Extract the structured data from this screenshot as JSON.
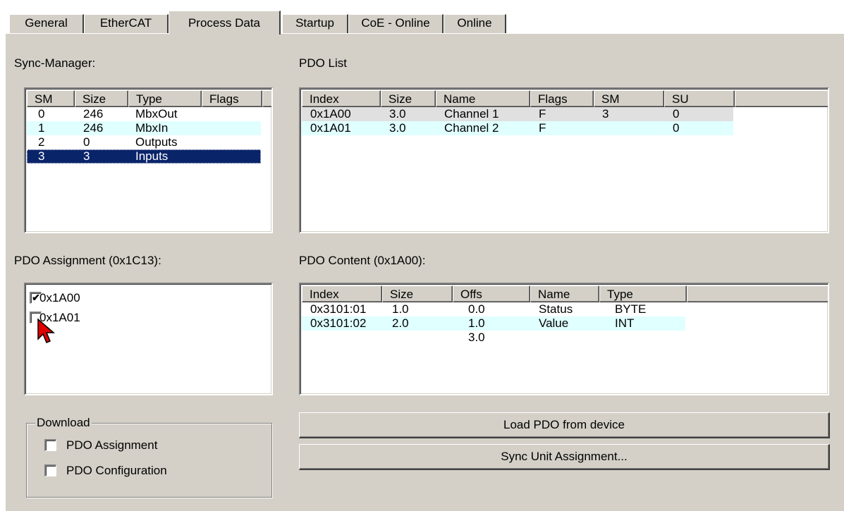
{
  "tabs": [
    {
      "label": "General"
    },
    {
      "label": "EtherCAT"
    },
    {
      "label": "Process Data"
    },
    {
      "label": "Startup"
    },
    {
      "label": "CoE - Online"
    },
    {
      "label": "Online"
    }
  ],
  "sync_manager": {
    "label": "Sync-Manager:",
    "columns": [
      "SM",
      "Size",
      "Type",
      "Flags"
    ],
    "rows": [
      {
        "sm": "0",
        "size": "246",
        "type": "MbxOut",
        "flags": ""
      },
      {
        "sm": "1",
        "size": "246",
        "type": "MbxIn",
        "flags": ""
      },
      {
        "sm": "2",
        "size": "0",
        "type": "Outputs",
        "flags": ""
      },
      {
        "sm": "3",
        "size": "3",
        "type": "Inputs",
        "flags": ""
      }
    ],
    "selected_index": 3
  },
  "pdo_list": {
    "label": "PDO List",
    "columns": [
      "Index",
      "Size",
      "Name",
      "Flags",
      "SM",
      "SU"
    ],
    "rows": [
      {
        "index": "0x1A00",
        "size": "3.0",
        "name": "Channel 1",
        "flags": "F",
        "sm": "3",
        "su": "0"
      },
      {
        "index": "0x1A01",
        "size": "3.0",
        "name": "Channel 2",
        "flags": "F",
        "sm": "",
        "su": "0"
      }
    ]
  },
  "pdo_assignment": {
    "label": "PDO Assignment (0x1C13):",
    "items": [
      {
        "label": "0x1A00",
        "checked": true
      },
      {
        "label": "0x1A01",
        "checked": false
      }
    ]
  },
  "pdo_content": {
    "label": "PDO Content (0x1A00):",
    "columns": [
      "Index",
      "Size",
      "Offs",
      "Name",
      "Type"
    ],
    "rows": [
      {
        "index": "0x3101:01",
        "size": "1.0",
        "offs": "0.0",
        "name": "Status",
        "type": "BYTE"
      },
      {
        "index": "0x3101:02",
        "size": "2.0",
        "offs": "1.0",
        "name": "Value",
        "type": "INT"
      },
      {
        "index": "",
        "size": "",
        "offs": "3.0",
        "name": "",
        "type": ""
      }
    ]
  },
  "download": {
    "title": "Download",
    "options": [
      {
        "label": "PDO Assignment",
        "checked": false
      },
      {
        "label": "PDO Configuration",
        "checked": false
      }
    ]
  },
  "buttons": {
    "load_pdo": "Load PDO from device",
    "sync_unit": "Sync Unit Assignment..."
  },
  "colors": {
    "dialog_face": "#d4d0c8",
    "selection": "#0a246a",
    "alt_row": "#e0ffff",
    "cursor_red": "#e00000"
  },
  "icons": {
    "cursor": "mouse-pointer-icon",
    "check": "checkmark-icon"
  }
}
